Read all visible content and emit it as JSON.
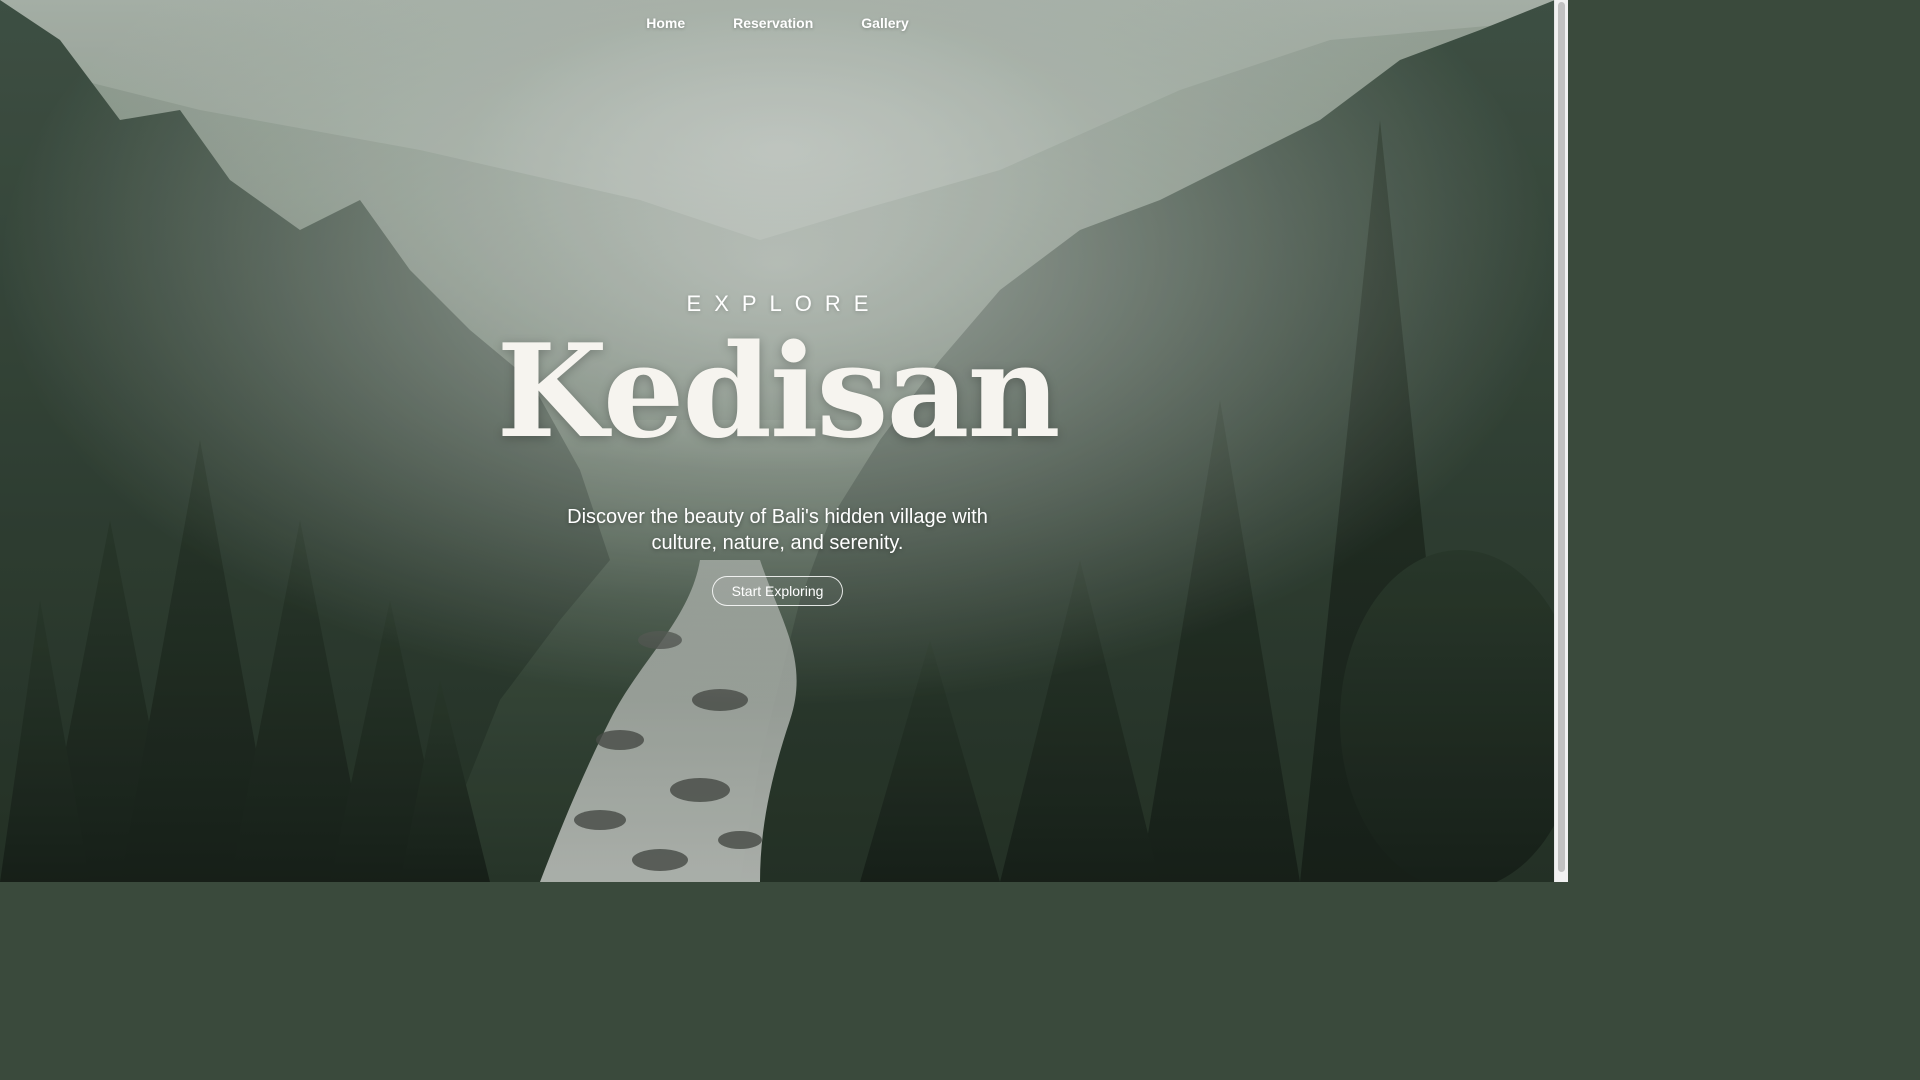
{
  "nav": {
    "items": [
      {
        "label": "Home"
      },
      {
        "label": "Reservation"
      },
      {
        "label": "Gallery"
      }
    ]
  },
  "hero": {
    "eyebrow": "EXPLORE",
    "title": "Kedisan",
    "tagline": "Discover the beauty of Bali's hidden village with culture, nature, and serenity.",
    "cta_label": "Start Exploring",
    "background": "misty forest valley with river"
  },
  "colors": {
    "text": "#ffffff",
    "brand": "#f6f4ef",
    "forest_dark": "#223024",
    "fog": "#c5cfc6"
  }
}
